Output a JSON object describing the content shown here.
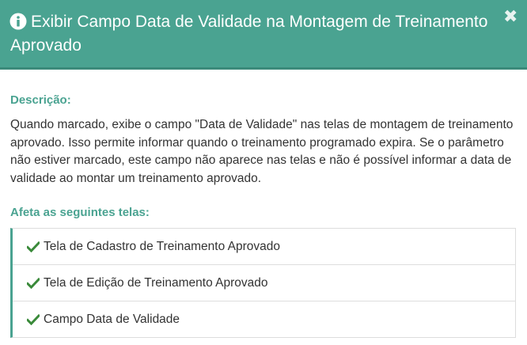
{
  "dialog": {
    "title": "Exibir Campo Data de Validade na Montagem de Treinamento Aprovado",
    "close_glyph": "✖",
    "info_icon": "info-circle",
    "close_icon": "close-x",
    "accent_color": "#4aa391"
  },
  "description": {
    "label": "Descrição:",
    "text": "Quando marcado, exibe o campo \"Data de Validade\" nas telas de montagem de treinamento aprovado. Isso permite informar quando o treinamento programado expira. Se o parâmetro não estiver marcado, este campo não aparece nas telas e não é possível informar a data de validade ao montar um treinamento aprovado."
  },
  "affected_screens": {
    "label": "Afeta as seguintes telas:",
    "item_icon": "check",
    "items": [
      {
        "label": "Tela de Cadastro de Treinamento Aprovado"
      },
      {
        "label": "Tela de Edição de Treinamento Aprovado"
      },
      {
        "label": "Campo Data de Validade"
      }
    ]
  }
}
